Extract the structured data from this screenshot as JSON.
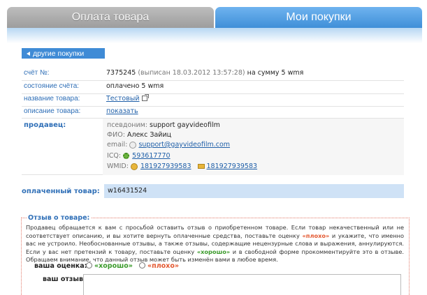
{
  "tabs": {
    "payment": "Оплата товара",
    "purchases": "Мои покупки"
  },
  "back_button": "другие покупки",
  "invoice": {
    "label": "счёт №:",
    "number": "7375245",
    "issued": "(выписан 18.03.2012 13:57:28)",
    "amount": "на сумму 5 wmя"
  },
  "status": {
    "label": "состояние счёта:",
    "value": "оплачено 5 wmя"
  },
  "product_name": {
    "label": "название товара:",
    "value": "Тестовый"
  },
  "product_desc": {
    "label": "описание товара:",
    "value": "показать"
  },
  "seller": {
    "label": "продавец:",
    "pseudonym_label": "псевдоним:",
    "pseudonym": "support gayvideofilm",
    "fio_label": "ФИО:",
    "fio": "Алекс Зайиц",
    "email_label": "email:",
    "email": "support@gayvideofilm.com",
    "icq_label": "ICQ:",
    "icq": "593617770",
    "wmid_label": "WMID:",
    "wmid": "181927939583",
    "purse": "181927939583"
  },
  "paid_item": {
    "label": "оплаченный товар:",
    "value": "w16431524"
  },
  "review": {
    "title": "Отзыв о товаре:",
    "text_1": "Продавец обращается к вам с просьбой оставить отзыв о приобретенном товаре. Если товар некачественный или не соответствует описанию, и вы хотите вернуть оплаченные средства, поставьте оценку",
    "bad_word": "«плохо»",
    "text_2": "и укажите, что именно вас не устроило. Необоснованные отзывы, а также отзывы, содержащие нецензурные слова и выражения, аннулируются. Если у вас нет претензий к товару, поставьте оценку",
    "good_word": "«хорошо»",
    "text_3": "и в свободной форме прокомментируйте это в отзыве. Обращаем внимание, что данный отзыв может быть изменён вами в любое время.",
    "rating_label": "ваша оценка:",
    "option_good": "«хорошо»",
    "option_bad": "«плохо»",
    "review_label": "ваш отзыв:"
  }
}
